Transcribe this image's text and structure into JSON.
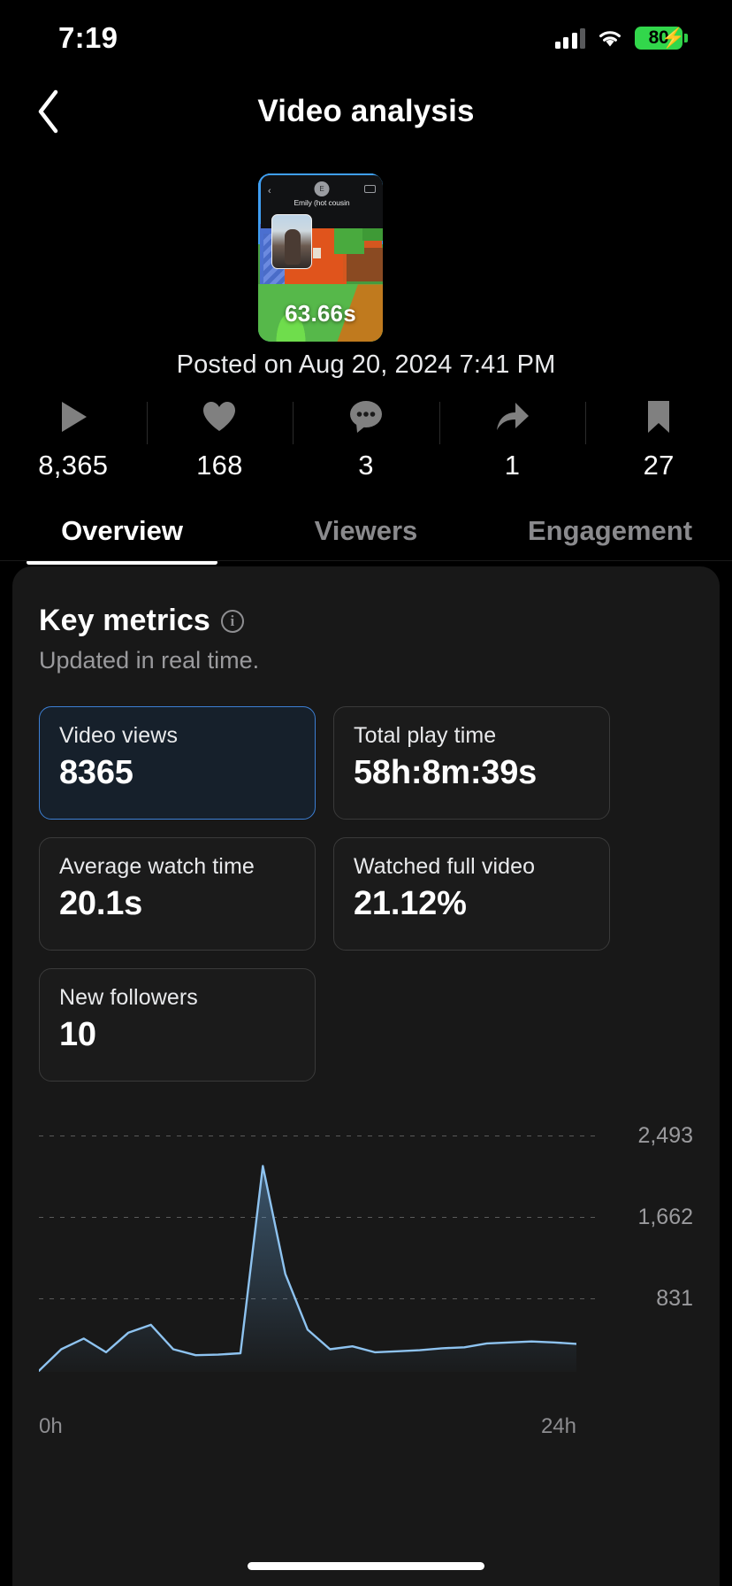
{
  "status_bar": {
    "time": "7:19",
    "battery_percent": "80",
    "battery_color": "#32d74b",
    "charging": true,
    "icons": [
      "cellular-signal-icon",
      "wifi-icon",
      "battery-icon"
    ]
  },
  "nav": {
    "back_icon": "chevron-left-icon",
    "title": "Video analysis"
  },
  "video": {
    "duration": "63.66s",
    "overlay_name": "Emily (hot cousin",
    "posted": "Posted on Aug 20, 2024 7:41 PM"
  },
  "stats": [
    {
      "icon": "play-icon",
      "name": "plays",
      "value": "8,365"
    },
    {
      "icon": "heart-icon",
      "name": "likes",
      "value": "168"
    },
    {
      "icon": "comment-icon",
      "name": "comments",
      "value": "3"
    },
    {
      "icon": "share-icon",
      "name": "shares",
      "value": "1"
    },
    {
      "icon": "bookmark-icon",
      "name": "favorites",
      "value": "27"
    }
  ],
  "tabs": [
    {
      "label": "Overview",
      "active": true
    },
    {
      "label": "Viewers",
      "active": false
    },
    {
      "label": "Engagement",
      "active": false
    }
  ],
  "key_metrics": {
    "title": "Key metrics",
    "info_icon": "info-icon",
    "subtitle": "Updated in real time.",
    "cards": [
      {
        "label": "Video views",
        "value": "8365",
        "selected": true
      },
      {
        "label": "Total play time",
        "value": "58h:8m:39s",
        "selected": false
      },
      {
        "label": "Average watch time",
        "value": "20.1s",
        "selected": false
      },
      {
        "label": "Watched full video",
        "value": "21.12%",
        "selected": false
      },
      {
        "label": "New followers",
        "value": "10",
        "selected": false
      }
    ]
  },
  "accent_color": "#3c7fd4",
  "line_color": "#8ec3f0",
  "chart_data": {
    "type": "line",
    "title": "",
    "xlabel": "",
    "ylabel": "",
    "x": [
      "0h",
      "1h",
      "2h",
      "3h",
      "4h",
      "5h",
      "6h",
      "7h",
      "8h",
      "9h",
      "10h",
      "11h",
      "12h",
      "13h",
      "14h",
      "15h",
      "16h",
      "17h",
      "18h",
      "19h",
      "20h",
      "21h",
      "22h",
      "23h",
      "24h"
    ],
    "tick_labels": [
      "0h",
      "24h"
    ],
    "gridlines": [
      2493,
      1662,
      831
    ],
    "gridline_labels": [
      "2,493",
      "1,662",
      "831"
    ],
    "ylim": [
      0,
      2493
    ],
    "grid": true,
    "legend": "none",
    "series": [
      {
        "name": "Video views",
        "values": [
          10,
          230,
          340,
          200,
          400,
          480,
          230,
          170,
          175,
          190,
          2100,
          1000,
          430,
          230,
          260,
          200,
          210,
          220,
          240,
          250,
          290,
          300,
          310,
          300,
          285
        ]
      }
    ]
  }
}
